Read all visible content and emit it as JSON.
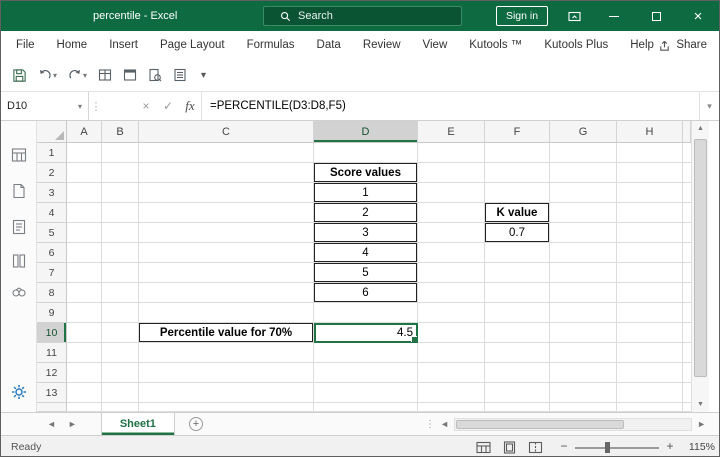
{
  "colors": {
    "accent_green": "#217346",
    "titlebar_green": "#0e6b41"
  },
  "titlebar": {
    "title": "percentile  -  Excel",
    "search_label": "Search",
    "sign_in_label": "Sign in"
  },
  "menu": {
    "tabs": [
      "File",
      "Home",
      "Insert",
      "Page Layout",
      "Formulas",
      "Data",
      "Review",
      "View",
      "Kutools ™",
      "Kutools Plus",
      "Help"
    ],
    "share_label": "Share"
  },
  "formula_bar": {
    "name_box_value": "D10",
    "fx_label": "fx",
    "formula": "=PERCENTILE(D3:D8,F5)"
  },
  "grid": {
    "columns": [
      "A",
      "B",
      "C",
      "D",
      "E",
      "F",
      "G",
      "H"
    ],
    "rows": [
      "1",
      "2",
      "3",
      "4",
      "5",
      "6",
      "7",
      "8",
      "9",
      "10",
      "11",
      "12",
      "13"
    ],
    "cells": {
      "D2": "Score values",
      "D3": "1",
      "D4": "2",
      "D5": "3",
      "D6": "4",
      "D7": "5",
      "D8": "6",
      "F4": "K value",
      "F5": "0.7",
      "C10": "Percentile value for 70%",
      "D10": "4.5"
    },
    "selected_cell": "D10",
    "selected_column": "D",
    "selected_row": "10"
  },
  "sheet_tabs": {
    "active_tab": "Sheet1",
    "add_label": "+"
  },
  "status_bar": {
    "mode": "Ready",
    "zoom_level": "115%"
  },
  "icons": {
    "dropdown": "▾",
    "check": "✓",
    "close": "×",
    "up_arrow": "▲",
    "down_arrow": "▼",
    "left_arrow": "◄",
    "right_arrow": "►",
    "minus": "−",
    "plus": "+",
    "dots": "⋮"
  }
}
